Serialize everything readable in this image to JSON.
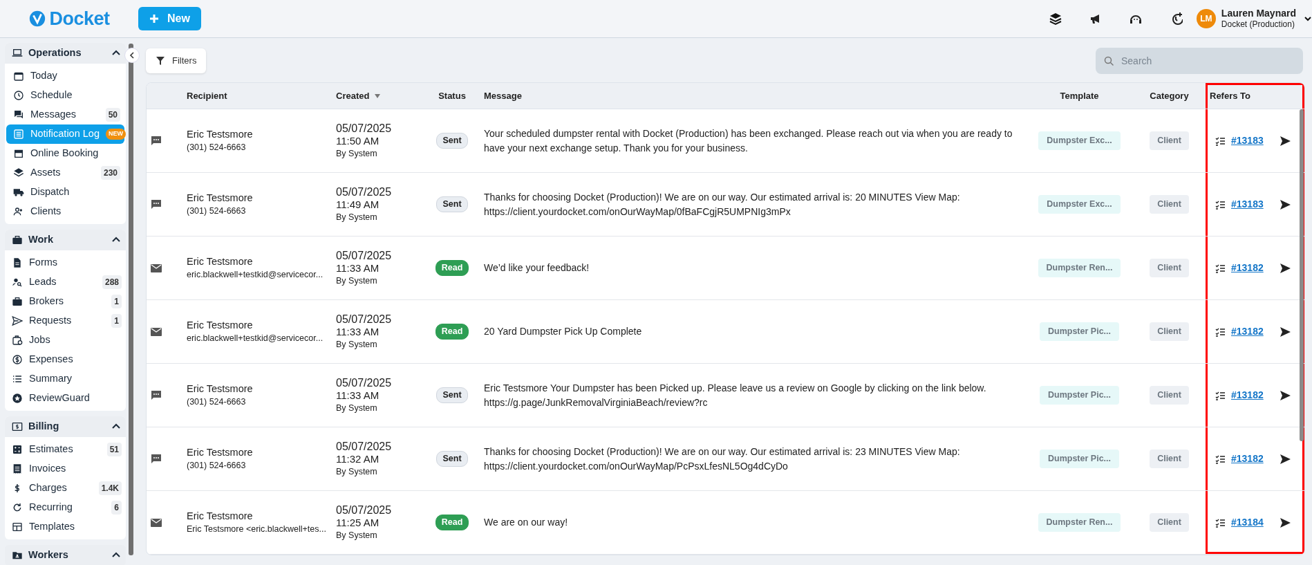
{
  "brand": {
    "name": "Docket"
  },
  "new_button": {
    "label": "New"
  },
  "user": {
    "initials": "LM",
    "name": "Lauren Maynard",
    "org": "Docket (Production)"
  },
  "sidebar": {
    "sections": [
      {
        "title": "Operations",
        "expanded": true,
        "items": [
          {
            "label": "Today",
            "selected": false
          },
          {
            "label": "Schedule",
            "selected": false
          },
          {
            "label": "Messages",
            "count": "50",
            "selected": false
          },
          {
            "label": "Notification Log",
            "tag": "NEW",
            "selected": true
          },
          {
            "label": "Online Booking",
            "selected": false
          },
          {
            "label": "Assets",
            "count": "230",
            "selected": false
          },
          {
            "label": "Dispatch",
            "selected": false
          },
          {
            "label": "Clients",
            "selected": false
          }
        ]
      },
      {
        "title": "Work",
        "expanded": true,
        "items": [
          {
            "label": "Forms",
            "selected": false
          },
          {
            "label": "Leads",
            "count": "288",
            "selected": false
          },
          {
            "label": "Brokers",
            "count": "1",
            "selected": false
          },
          {
            "label": "Requests",
            "count": "1",
            "selected": false
          },
          {
            "label": "Jobs",
            "selected": false
          },
          {
            "label": "Expenses",
            "selected": false
          },
          {
            "label": "Summary",
            "selected": false
          },
          {
            "label": "ReviewGuard",
            "selected": false
          }
        ]
      },
      {
        "title": "Billing",
        "expanded": true,
        "items": [
          {
            "label": "Estimates",
            "count": "51",
            "selected": false
          },
          {
            "label": "Invoices",
            "selected": false
          },
          {
            "label": "Charges",
            "count": "1.4K",
            "selected": false
          },
          {
            "label": "Recurring",
            "count": "6",
            "selected": false
          },
          {
            "label": "Templates",
            "selected": false
          }
        ]
      },
      {
        "title": "Workers",
        "expanded": true
      }
    ]
  },
  "filters_button": {
    "label": "Filters"
  },
  "search": {
    "placeholder": "Search"
  },
  "table": {
    "columns": [
      {
        "label": "Recipient",
        "sorted": false,
        "highlighted": false
      },
      {
        "label": "Created",
        "sorted": true,
        "highlighted": false
      },
      {
        "label": "Status",
        "sorted": false,
        "highlighted": false
      },
      {
        "label": "Message",
        "sorted": false,
        "highlighted": false
      },
      {
        "label": "Template",
        "sorted": false,
        "highlighted": false
      },
      {
        "label": "Category",
        "sorted": false,
        "highlighted": false
      },
      {
        "label": "Refers To",
        "sorted": false,
        "highlighted": true
      }
    ],
    "rows": [
      {
        "kind": "sms",
        "name": "Eric Testsmore",
        "contact": "(301) 524-6663",
        "date": "05/07/2025",
        "time": "11:50 AM",
        "by": "By System",
        "status": "Sent",
        "read": false,
        "message": "Your scheduled dumpster rental with Docket (Production) has been exchanged. Please reach out via when you are ready to have your next exchange setup. Thank you for your business.",
        "template": "Dumpster Exc...",
        "category": "Client",
        "ref": "#13183"
      },
      {
        "kind": "sms",
        "name": "Eric Testsmore",
        "contact": "(301) 524-6663",
        "date": "05/07/2025",
        "time": "11:49 AM",
        "by": "By System",
        "status": "Sent",
        "read": false,
        "message": "Thanks for choosing Docket (Production)! We are on our way. Our estimated arrival is: 20 MINUTES View Map: https://client.yourdocket.com/onOurWayMap/0fBaFCgjR5UMPNIg3mPx",
        "template": "Dumpster Exc...",
        "category": "Client",
        "ref": "#13183"
      },
      {
        "kind": "email",
        "name": "Eric Testsmore",
        "contact": "eric.blackwell+testkid@servicecor...",
        "date": "05/07/2025",
        "time": "11:33 AM",
        "by": "By System",
        "status": "Read",
        "read": true,
        "message": "We’d like your feedback!",
        "template": "Dumpster Ren...",
        "category": "Client",
        "ref": "#13182"
      },
      {
        "kind": "email",
        "name": "Eric Testsmore",
        "contact": "eric.blackwell+testkid@servicecor...",
        "date": "05/07/2025",
        "time": "11:33 AM",
        "by": "By System",
        "status": "Read",
        "read": true,
        "message": "20 Yard Dumpster Pick Up Complete",
        "template": "Dumpster Pic...",
        "category": "Client",
        "ref": "#13182"
      },
      {
        "kind": "sms",
        "name": "Eric Testsmore",
        "contact": "(301) 524-6663",
        "date": "05/07/2025",
        "time": "11:33 AM",
        "by": "By System",
        "status": "Sent",
        "read": false,
        "message": "Eric Testsmore Your Dumpster has been Picked up. Please leave us a review on Google by clicking on the link below. https://g.page/JunkRemovalVirginiaBeach/review?rc",
        "template": "Dumpster Pic...",
        "category": "Client",
        "ref": "#13182"
      },
      {
        "kind": "sms",
        "name": "Eric Testsmore",
        "contact": "(301) 524-6663",
        "date": "05/07/2025",
        "time": "11:32 AM",
        "by": "By System",
        "status": "Sent",
        "read": false,
        "message": "Thanks for choosing Docket (Production)! We are on our way. Our estimated arrival is: 23 MINUTES View Map: https://client.yourdocket.com/onOurWayMap/PcPsxLfesNL5Og4dCyDo",
        "template": "Dumpster Pic...",
        "category": "Client",
        "ref": "#13182"
      },
      {
        "kind": "email",
        "name": "Eric Testsmore",
        "contact": "Eric Testsmore <eric.blackwell+tes...",
        "date": "05/07/2025",
        "time": "11:25 AM",
        "by": "By System",
        "status": "Read",
        "read": true,
        "message": "We are on our way!",
        "template": "Dumpster Ren...",
        "category": "Client",
        "ref": "#13184"
      }
    ]
  }
}
